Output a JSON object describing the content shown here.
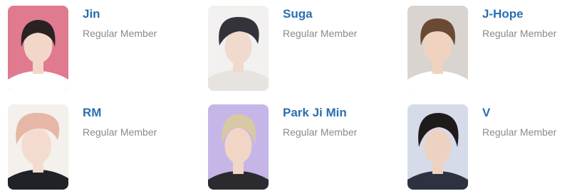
{
  "members": [
    {
      "name": "Jin",
      "role": "Regular Member",
      "photo": {
        "bg": "#e07a8f",
        "hair": "#2a2222",
        "skin": "#f2d7c8",
        "clothes": "#ffffff"
      }
    },
    {
      "name": "Suga",
      "role": "Regular Member",
      "photo": {
        "bg": "#f3f1ef",
        "hair": "#35333a",
        "skin": "#f0d9cd",
        "clothes": "#e7e3df"
      }
    },
    {
      "name": "J-Hope",
      "role": "Regular Member",
      "photo": {
        "bg": "#d9d4cf",
        "hair": "#6b4a34",
        "skin": "#efd3c0",
        "clothes": "#ffffff"
      }
    },
    {
      "name": "RM",
      "role": "Regular Member",
      "photo": {
        "bg": "#f4f0ec",
        "hair": "#e6b7a6",
        "skin": "#f3dccf",
        "clothes": "#1f2226"
      }
    },
    {
      "name": "Park Ji Min",
      "role": "Regular Member",
      "photo": {
        "bg": "#c6b6e8",
        "hair": "#d8c9a4",
        "skin": "#f1d6c6",
        "clothes": "#2b2b2f"
      }
    },
    {
      "name": "V",
      "role": "Regular Member",
      "photo": {
        "bg": "#d6dbe9",
        "hair": "#201b1b",
        "skin": "#eed2c1",
        "clothes": "#2e3140"
      }
    }
  ]
}
